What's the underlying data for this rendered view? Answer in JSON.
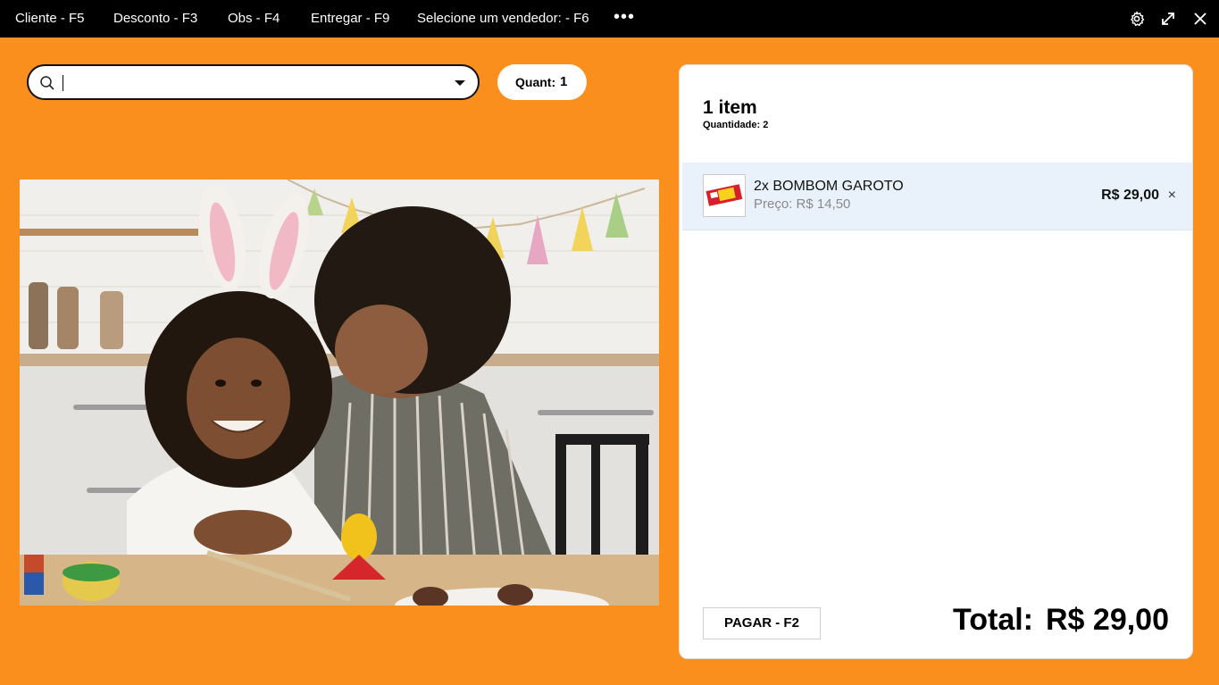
{
  "topbar": {
    "menu": [
      {
        "label": "Cliente - F5"
      },
      {
        "label": "Desconto - F3"
      },
      {
        "label": "Obs - F4"
      },
      {
        "label": "Entregar - F9"
      },
      {
        "label": "Selecione um vendedor: - F6"
      }
    ],
    "more": "•••",
    "icons": [
      "gear-icon",
      "expand-icon",
      "close-icon"
    ]
  },
  "search": {
    "value": "",
    "placeholder": ""
  },
  "quantity": {
    "label": "Quant:",
    "value": "1"
  },
  "cart": {
    "title": "1 item",
    "quantity_label": "Quantidade: 2",
    "items": [
      {
        "name": "2x BOMBOM GAROTO",
        "price": "Preço: R$ 14,50",
        "total": "R$ 29,00",
        "remove": "×"
      }
    ],
    "pay_label": "PAGAR - F2",
    "total_label": "Total:",
    "total_value": "R$ 29,00"
  },
  "colors": {
    "background": "#fb8f1d",
    "topbar": "#000000",
    "item_highlight": "#e9f2fb"
  }
}
